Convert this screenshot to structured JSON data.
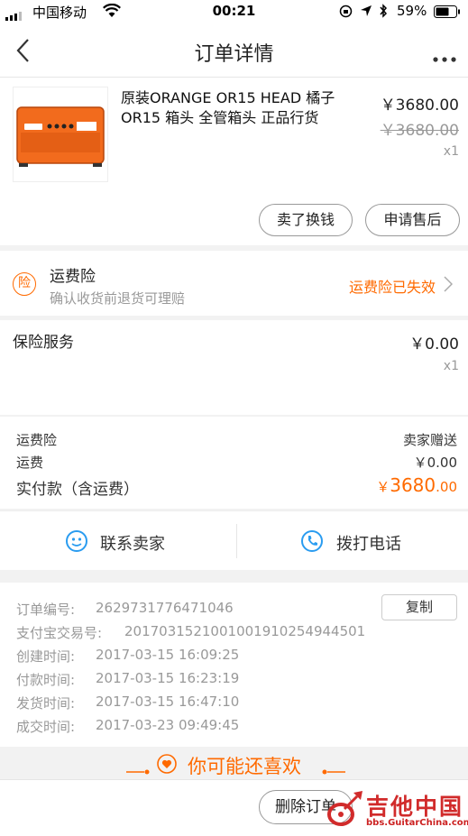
{
  "status_bar": {
    "carrier": "中国移动",
    "time": "00:21",
    "battery": "59%"
  },
  "nav": {
    "title": "订单详情",
    "back_icon": "chevron-left-icon",
    "more_icon": "more-dots-icon"
  },
  "product": {
    "title": "原装ORANGE OR15 HEAD 橘子OR15  箱头 全管箱头 正品行货",
    "price": "￥3680.00",
    "original_price": "￥3680.00",
    "quantity": "x1",
    "sell_button": "卖了换钱",
    "aftersale_button": "申请售后"
  },
  "insurance": {
    "badge": "险",
    "name": "运费险",
    "desc": "确认收货前退货可理赔",
    "status": "运费险已失效"
  },
  "service": {
    "label": "保险服务",
    "price": "￥0.00",
    "quantity": "x1"
  },
  "summary": {
    "shipping_ins_label": "运费险",
    "shipping_ins_value": "卖家赠送",
    "shipping_label": "运费",
    "shipping_value": "￥0.00",
    "paid_label": "实付款（含运费）",
    "paid_currency": "￥",
    "paid_int": "3680",
    "paid_dec": ".00"
  },
  "contact": {
    "seller_label": "联系卖家",
    "call_label": "拨打电话"
  },
  "order_info": {
    "copy_button": "复制",
    "rows": [
      {
        "label": "订单编号:",
        "value": "2629731776471046"
      },
      {
        "label": "支付宝交易号:",
        "value": "2017031521001001910254944501"
      },
      {
        "label": "创建时间:",
        "value": "2017-03-15 16:09:25"
      },
      {
        "label": "付款时间:",
        "value": "2017-03-15 16:23:19"
      },
      {
        "label": "发货时间:",
        "value": "2017-03-15 16:47:10"
      },
      {
        "label": "成交时间:",
        "value": "2017-03-23 09:49:45"
      }
    ]
  },
  "recommend": {
    "title": "你可能还喜欢"
  },
  "bottom": {
    "delete_button": "删除订单"
  },
  "watermark": {
    "name": "吉他中国",
    "url": "bbs.GuitarChina.com"
  },
  "colors": {
    "accent": "#ff6a00",
    "service_icon": "#2a9cf0"
  }
}
